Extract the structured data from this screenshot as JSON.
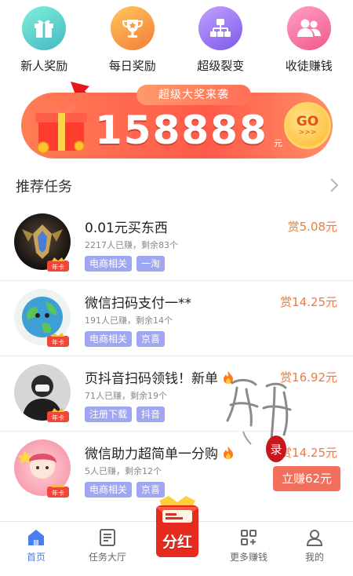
{
  "categories": [
    {
      "label": "新人奖励",
      "icon": "gift-icon"
    },
    {
      "label": "每日奖励",
      "icon": "trophy-icon"
    },
    {
      "label": "超级裂变",
      "icon": "network-icon"
    },
    {
      "label": "收徒赚钱",
      "icon": "users-icon"
    }
  ],
  "banner": {
    "tag": "超级大奖来袭",
    "amount": "158888",
    "unit": "元",
    "go_label": "GO",
    "go_arrows": ">>>"
  },
  "section": {
    "title": "推荐任务"
  },
  "tasks": [
    {
      "title": "0.01元买东西",
      "meta": "2217人已赚，剩余83个",
      "tags": [
        "电商相关",
        "一淘"
      ],
      "reward": "赏5.08元"
    },
    {
      "title": "微信扫码支付一**",
      "meta": "191人已赚，剩余14个",
      "tags": [
        "电商相关",
        "京喜"
      ],
      "reward": "赏14.25元"
    },
    {
      "title": "页抖音扫码领钱！新单",
      "meta": "71人已赚，剩余19个",
      "tags": [
        "注册下载",
        "抖音"
      ],
      "reward": "赏16.92元"
    },
    {
      "title": "微信助力超简单一分购",
      "meta": "5人已赚，剩余12个",
      "tags": [
        "电商相关",
        "京喜"
      ],
      "reward": "赏14.25元",
      "button": "立赚62元"
    }
  ],
  "badge_text": "年卡",
  "watermark_seal": "录",
  "bottom_nav": [
    {
      "label": "首页",
      "icon": "home-icon",
      "active": true
    },
    {
      "label": "任务大厅",
      "icon": "task-list-icon"
    },
    {
      "label": "分红",
      "icon": "red-envelope-icon"
    },
    {
      "label": "更多赚钱",
      "icon": "grid-icon"
    },
    {
      "label": "我的",
      "icon": "profile-icon"
    }
  ],
  "colors": {
    "accent_blue": "#4a7df0",
    "reward_orange": "#f07a3a",
    "tag_purple": "#9fa6f2",
    "banner_red": "#ff5a4a"
  }
}
